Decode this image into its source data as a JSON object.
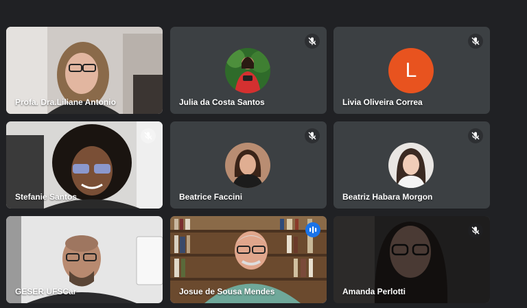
{
  "meeting": {
    "participants": [
      {
        "name": "Profa. Dra.Liliane Antonio",
        "muted": false,
        "video": true
      },
      {
        "name": "Julia da Costa Santos",
        "muted": true,
        "video": false,
        "avatar": "photo"
      },
      {
        "name": "Livia Oliveira Correa",
        "muted": true,
        "video": false,
        "avatar_letter": "L",
        "avatar_color": "#e8531f"
      },
      {
        "name": "Stefanie Santos",
        "muted": true,
        "video": true
      },
      {
        "name": "Beatrice Faccini",
        "muted": true,
        "video": false,
        "avatar": "photo"
      },
      {
        "name": "Beatriz Habara Morgon",
        "muted": true,
        "video": false,
        "avatar": "photo"
      },
      {
        "name": "GESER UFSCar",
        "muted": false,
        "video": true
      },
      {
        "name": "Josue de Sousa Mendes",
        "muted": false,
        "video": true,
        "speaking": true
      },
      {
        "name": "Amanda Perlotti",
        "muted": true,
        "video": true
      }
    ]
  },
  "colors": {
    "background": "#202124",
    "tile": "#3c4043",
    "speaking_indicator": "#1a73e8",
    "speaking_border": "#8ab4f8"
  }
}
